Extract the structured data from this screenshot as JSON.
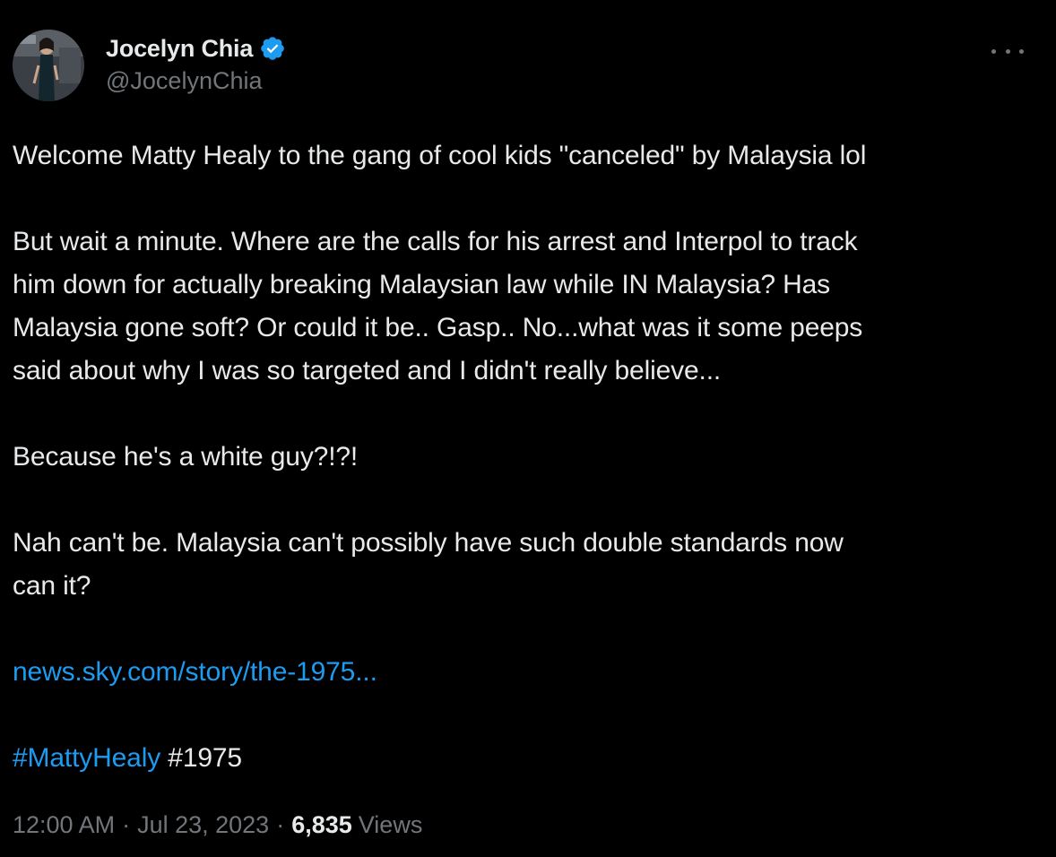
{
  "author": {
    "display_name": "Jocelyn Chia",
    "handle": "@JocelynChia",
    "verified": true,
    "avatar_icon": "avatar-photo"
  },
  "tweet": {
    "paragraphs": [
      "Welcome Matty Healy to the gang of cool kids \"canceled\" by Malaysia lol",
      "But wait a minute. Where are the calls for his arrest and Interpol to track\nhim down for actually breaking Malaysian law while IN Malaysia? Has\nMalaysia gone soft? Or could it be.. Gasp.. No...what was it some peeps\nsaid about why I was so targeted and I didn't really believe...",
      "Because he's a white guy?!?!",
      "Nah can't be. Malaysia can't possibly have such double standards now\ncan it?"
    ],
    "link_text": "news.sky.com/story/the-1975...",
    "hashtag_link": "#MattyHealy",
    "hashtag_plain": "#1975"
  },
  "meta": {
    "time": "12:00 AM",
    "separator": "·",
    "date": "Jul 23, 2023",
    "views_count": "6,835",
    "views_label": "Views"
  },
  "colors": {
    "background": "#000000",
    "text": "#e7e9ea",
    "secondary": "#71767b",
    "link": "#1d9bf0"
  }
}
